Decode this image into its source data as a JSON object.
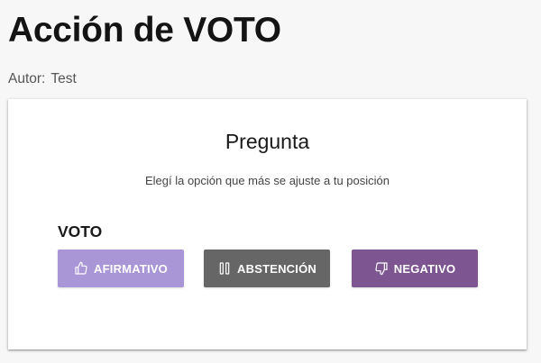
{
  "header": {
    "title": "Acción de VOTO",
    "author_label": "Autor:",
    "author_value": "Test"
  },
  "card": {
    "title": "Pregunta",
    "subtitle": "Elegí la opción que más se ajuste a tu posición",
    "section_label": "VOTO",
    "buttons": [
      {
        "label": "AFIRMATIVO",
        "icon": "thumbs-up-icon",
        "color": "#a896d6"
      },
      {
        "label": "ABSTENCIÓN",
        "icon": "pause-icon",
        "color": "#666666"
      },
      {
        "label": "NEGATIVO",
        "icon": "thumbs-down-icon",
        "color": "#7c5591"
      }
    ]
  }
}
